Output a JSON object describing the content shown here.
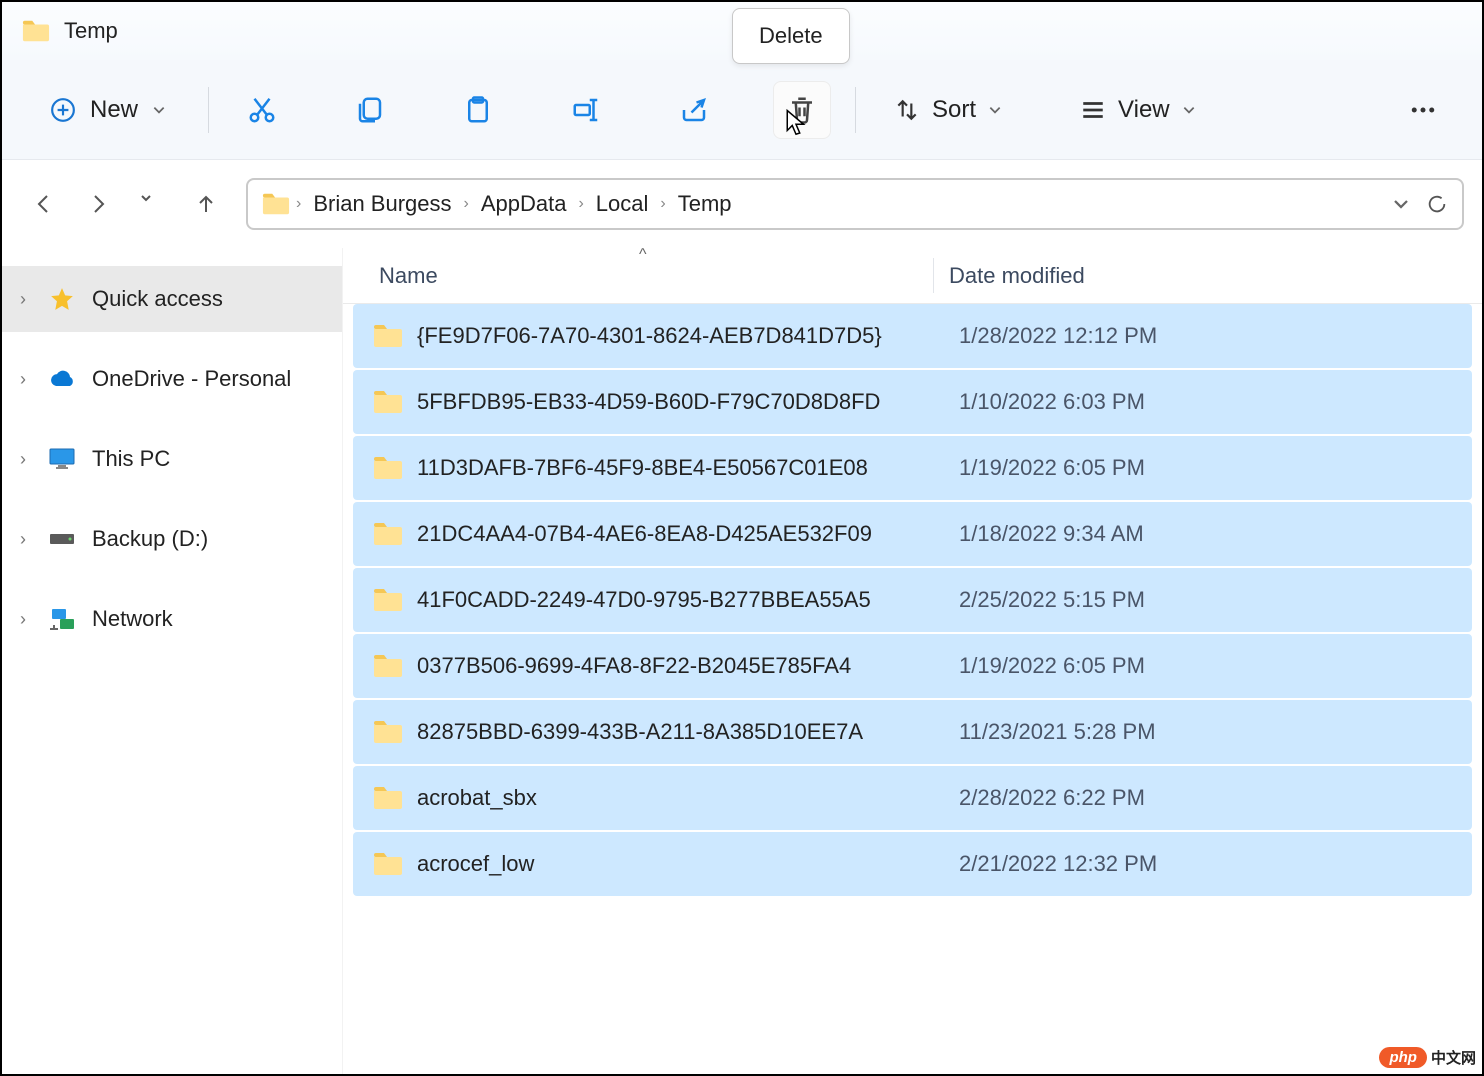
{
  "window": {
    "title": "Temp"
  },
  "toolbar": {
    "new_label": "New",
    "sort_label": "Sort",
    "view_label": "View",
    "tooltip": "Delete"
  },
  "breadcrumb": {
    "items": [
      "Brian Burgess",
      "AppData",
      "Local",
      "Temp"
    ]
  },
  "sidebar": {
    "items": [
      {
        "label": "Quick access",
        "icon": "star"
      },
      {
        "label": "OneDrive - Personal",
        "icon": "cloud"
      },
      {
        "label": "This PC",
        "icon": "monitor"
      },
      {
        "label": "Backup (D:)",
        "icon": "drive"
      },
      {
        "label": "Network",
        "icon": "network"
      }
    ]
  },
  "columns": {
    "name": "Name",
    "date": "Date modified"
  },
  "files": [
    {
      "name": "{FE9D7F06-7A70-4301-8624-AEB7D841D7D5}",
      "date": "1/28/2022 12:12 PM"
    },
    {
      "name": "5FBFDB95-EB33-4D59-B60D-F79C70D8D8FD",
      "date": "1/10/2022 6:03 PM"
    },
    {
      "name": "11D3DAFB-7BF6-45F9-8BE4-E50567C01E08",
      "date": "1/19/2022 6:05 PM"
    },
    {
      "name": "21DC4AA4-07B4-4AE6-8EA8-D425AE532F09",
      "date": "1/18/2022 9:34 AM"
    },
    {
      "name": "41F0CADD-2249-47D0-9795-B277BBEA55A5",
      "date": "2/25/2022 5:15 PM"
    },
    {
      "name": "0377B506-9699-4FA8-8F22-B2045E785FA4",
      "date": "1/19/2022 6:05 PM"
    },
    {
      "name": "82875BBD-6399-433B-A211-8A385D10EE7A",
      "date": "11/23/2021 5:28 PM"
    },
    {
      "name": "acrobat_sbx",
      "date": "2/28/2022 6:22 PM"
    },
    {
      "name": "acrocef_low",
      "date": "2/21/2022 12:32 PM"
    }
  ],
  "watermark": {
    "brand": "php",
    "text": "中文网"
  }
}
